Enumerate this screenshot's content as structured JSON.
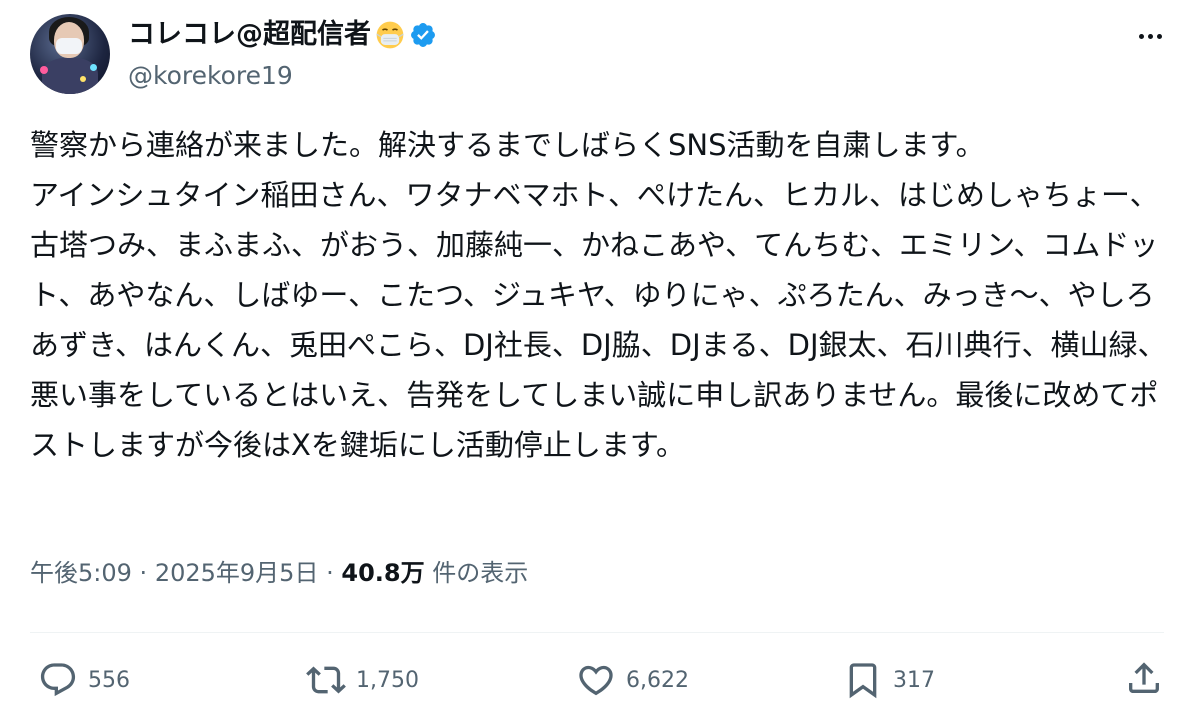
{
  "tweet": {
    "display_name": "コレコレ@超配信者",
    "handle": "@korekore19",
    "text": "警察から連絡が来ました。解決するまでしばらくSNS活動を自粛します。\nアインシュタイン稲田さん、ワタナベマホト、ぺけたん、ヒカル、はじめしゃちょー、古塔つみ、まふまふ、がおう、加藤純一、かねこあや、てんちむ、エミリン、コムドット、あやなん、しばゆー、こたつ、ジュキヤ、ゆりにゃ、ぷろたん、みっき〜、やしろあずき、はんくん、兎田ぺこら、DJ社長、DJ脇、DJまる、DJ銀太、石川典行、横山緑、悪い事をしているとはいえ、告発をしてしまい誠に申し訳ありません。最後に改めてポストしますが今後はXを鍵垢にし活動停止します。",
    "time": "午後5:09",
    "separator": "·",
    "date": "2025年9月5日",
    "views_count": "40.8万",
    "views_label": "件の表示"
  },
  "actions": {
    "reply_count": "556",
    "retweet_count": "1,750",
    "like_count": "6,622",
    "bookmark_count": "317"
  },
  "icons": {
    "emoji": "face-with-medical-mask-icon",
    "verified": "verified-badge-icon",
    "more": "more-icon",
    "reply": "reply-icon",
    "retweet": "retweet-icon",
    "like": "heart-icon",
    "bookmark": "bookmark-icon",
    "share": "share-icon"
  },
  "colors": {
    "text": "#0f1419",
    "secondary": "#536471",
    "verified": "#1d9bf0",
    "divider": "#eff3f4"
  }
}
